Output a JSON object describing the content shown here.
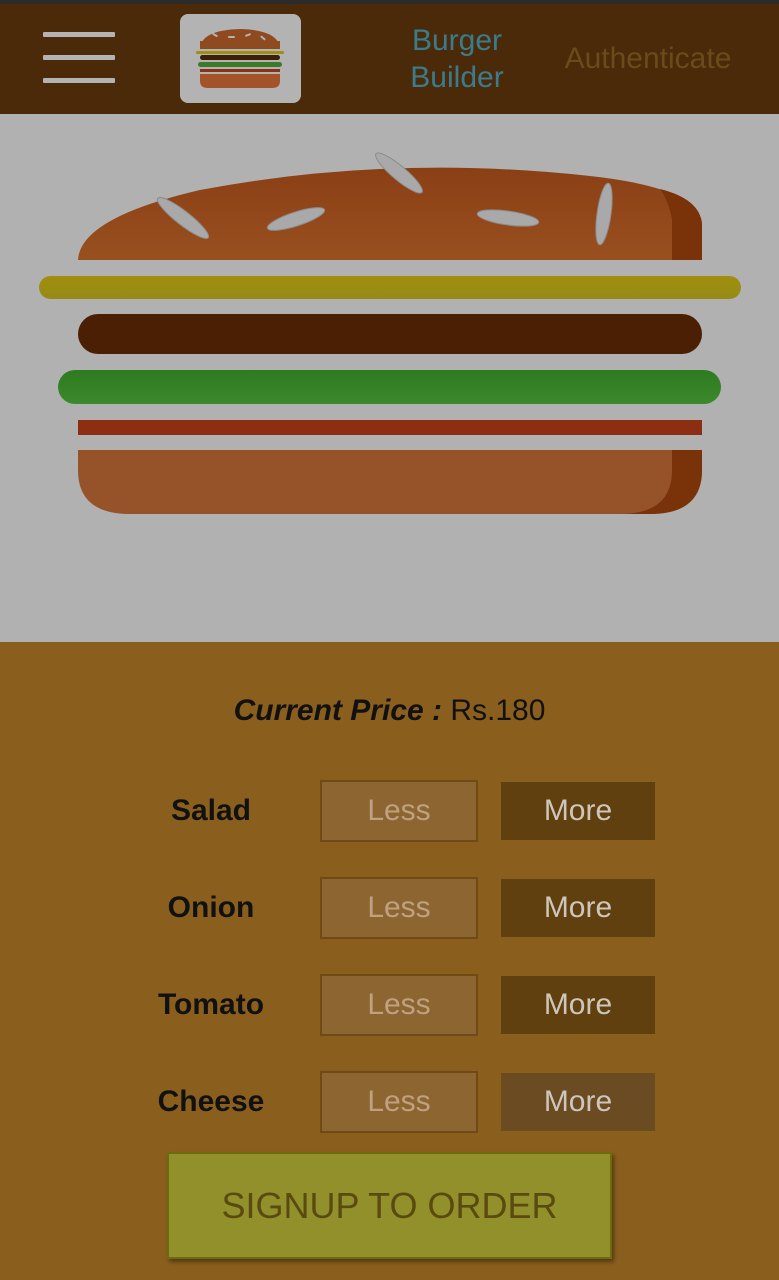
{
  "header": {
    "logo_icon": "burger-logo-icon",
    "menu_icon": "hamburger-menu-icon",
    "nav_burger_builder": "Burger Builder",
    "nav_authenticate": "Authenticate"
  },
  "colors": {
    "header_bg": "#4b2a09",
    "preview_bg": "#b1b1b1",
    "controls_bg": "#8a5f1e",
    "order_button_bg": "#92902a",
    "active_link": "#3b7c8c"
  },
  "controls": {
    "price_label": "Current Price :",
    "price_value": "Rs.180",
    "ingredients": [
      {
        "label": "Salad",
        "less": "Less",
        "more": "More"
      },
      {
        "label": "Onion",
        "less": "Less",
        "more": "More"
      },
      {
        "label": "Tomato",
        "less": "Less",
        "more": "More"
      },
      {
        "label": "Cheese",
        "less": "Less",
        "more": "More"
      }
    ],
    "order_button": "SIGNUP TO ORDER"
  }
}
